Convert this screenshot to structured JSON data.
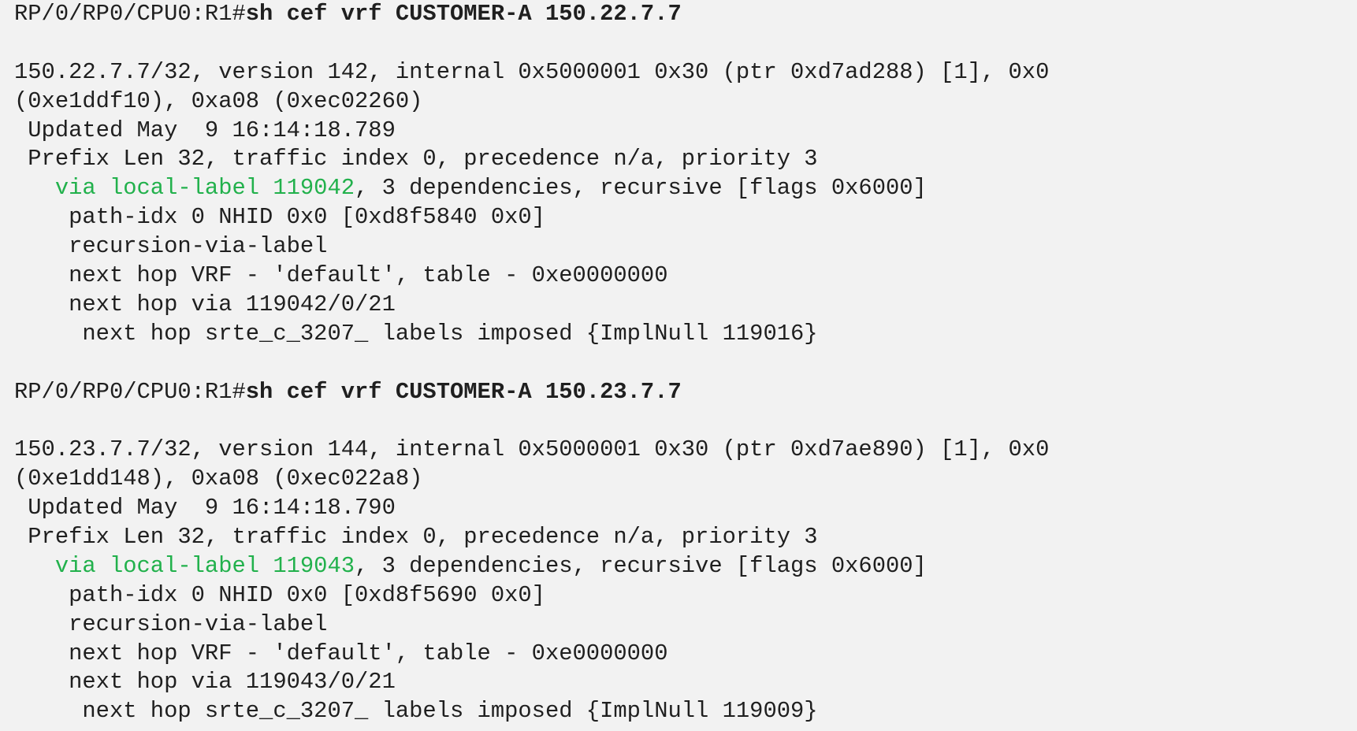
{
  "terminal": {
    "colors": {
      "background": "#f2f2f2",
      "text": "#1f1f1f",
      "highlight": "#22b14c"
    },
    "blocks": [
      {
        "prompt": "RP/0/RP0/CPU0:R1#",
        "command": "sh cef vrf CUSTOMER-A 150.22.7.7",
        "entry_line1": "150.22.7.7/32, version 142, internal 0x5000001 0x30 (ptr 0xd7ad288) [1], 0x0",
        "entry_line2": "(0xe1ddf10), 0xa08 (0xec02260)",
        "updated": " Updated May  9 16:14:18.789",
        "prefix_len": " Prefix Len 32, traffic index 0, precedence n/a, priority 3",
        "via_indent": "   ",
        "via_label": "via local-label 119042",
        "via_rest": ", 3 dependencies, recursive [flags 0x6000]",
        "path_idx": "    path-idx 0 NHID 0x0 [0xd8f5840 0x0]",
        "recursion": "    recursion-via-label",
        "next_hop_vrf": "    next hop VRF - 'default', table - 0xe0000000",
        "next_hop_via": "    next hop via 119042/0/21",
        "next_hop_srte": "     next hop srte_c_3207_ labels imposed {ImplNull 119016}"
      },
      {
        "prompt": "RP/0/RP0/CPU0:R1#",
        "command": "sh cef vrf CUSTOMER-A 150.23.7.7",
        "entry_line1": "150.23.7.7/32, version 144, internal 0x5000001 0x30 (ptr 0xd7ae890) [1], 0x0",
        "entry_line2": "(0xe1dd148), 0xa08 (0xec022a8)",
        "updated": " Updated May  9 16:14:18.790",
        "prefix_len": " Prefix Len 32, traffic index 0, precedence n/a, priority 3",
        "via_indent": "   ",
        "via_label": "via local-label 119043",
        "via_rest": ", 3 dependencies, recursive [flags 0x6000]",
        "path_idx": "    path-idx 0 NHID 0x0 [0xd8f5690 0x0]",
        "recursion": "    recursion-via-label",
        "next_hop_vrf": "    next hop VRF - 'default', table - 0xe0000000",
        "next_hop_via": "    next hop via 119043/0/21",
        "next_hop_srte": "     next hop srte_c_3207_ labels imposed {ImplNull 119009}"
      }
    ]
  }
}
